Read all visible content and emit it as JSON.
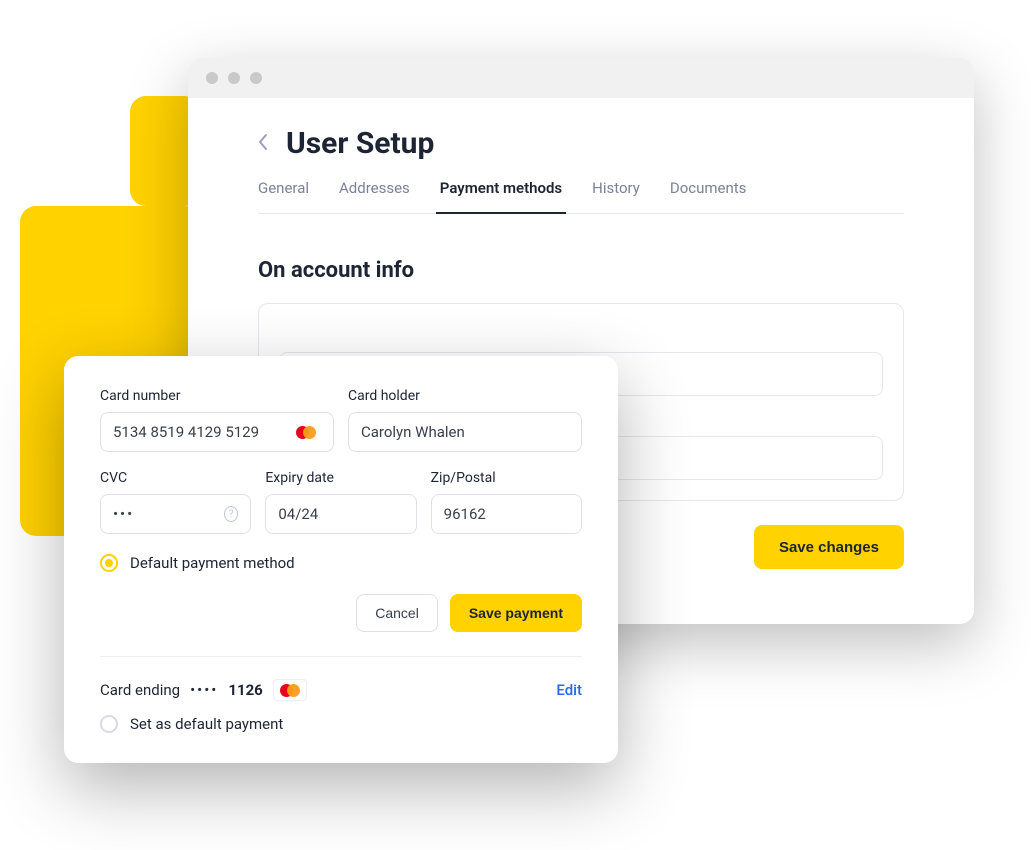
{
  "page": {
    "title": "User Setup",
    "section_title": "On account info"
  },
  "tabs": {
    "general": "General",
    "addresses": "Addresses",
    "payment_methods": "Payment methods",
    "history": "History",
    "documents": "Documents",
    "active": "payment_methods"
  },
  "buttons": {
    "save_changes": "Save changes",
    "cancel": "Cancel",
    "save_payment": "Save payment",
    "edit": "Edit"
  },
  "form": {
    "labels": {
      "card_number": "Card number",
      "card_holder": "Card holder",
      "cvc": "CVC",
      "expiry": "Expiry date",
      "zip": "Zip/Postal",
      "default_payment": "Default payment method",
      "set_default": "Set as default payment"
    },
    "values": {
      "card_number": "5134 8519 4129 5129",
      "card_holder": "Carolyn Whalen",
      "cvc_mask": "•••",
      "expiry": "04/24",
      "zip": "96162"
    },
    "card_brand": "mastercard",
    "default_selected": true
  },
  "saved_card": {
    "label": "Card ending",
    "mask": "••••",
    "last4": "1126",
    "brand": "mastercard",
    "is_default": false
  }
}
